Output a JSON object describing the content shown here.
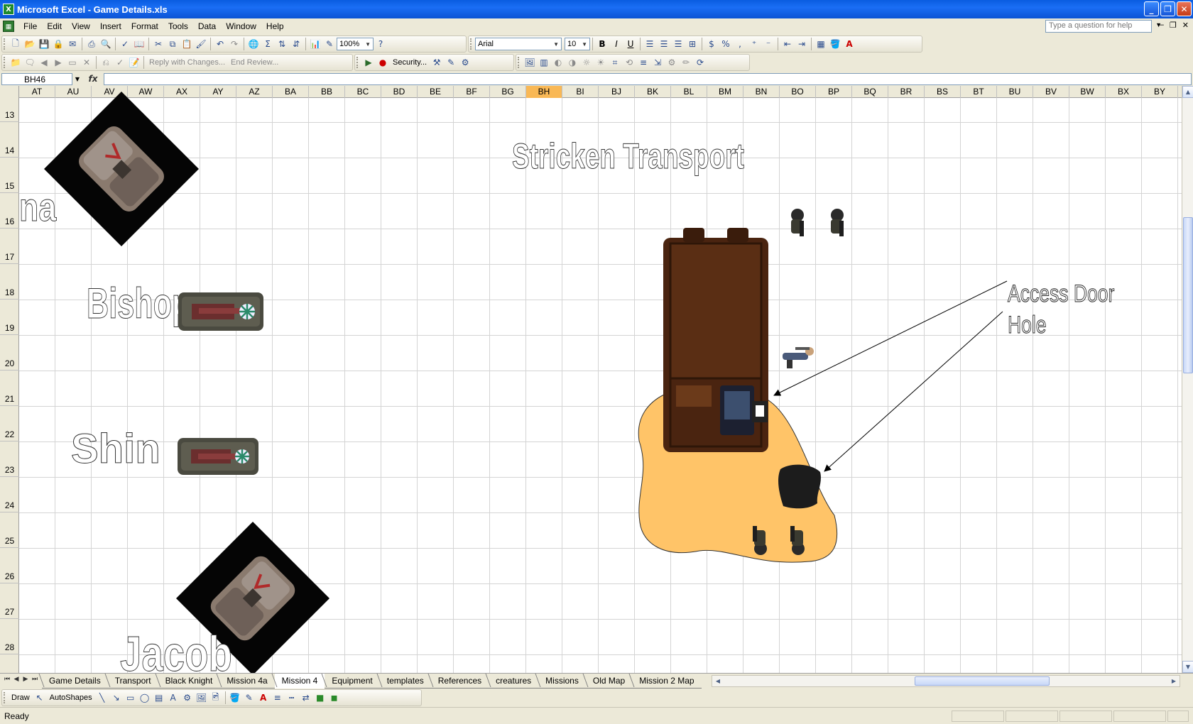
{
  "window": {
    "title": "Microsoft Excel - Game Details.xls"
  },
  "menu": [
    "File",
    "Edit",
    "View",
    "Insert",
    "Format",
    "Tools",
    "Data",
    "Window",
    "Help"
  ],
  "help_placeholder": "Type a question for help",
  "toolbar": {
    "zoom": "100%",
    "font": "Arial",
    "font_size": "10",
    "reply_with_changes": "Reply with Changes...",
    "end_review": "End Review...",
    "security": "Security..."
  },
  "formula_bar": {
    "name_box": "BH46",
    "fx": "fx",
    "content": ""
  },
  "columns": [
    "AT",
    "AU",
    "AV",
    "AW",
    "AX",
    "AY",
    "AZ",
    "BA",
    "BB",
    "BC",
    "BD",
    "BE",
    "BF",
    "BG",
    "BH",
    "BI",
    "BJ",
    "BK",
    "BL",
    "BM",
    "BN",
    "BO",
    "BP",
    "BQ",
    "BR",
    "BS",
    "BT",
    "BU",
    "BV",
    "BW",
    "BX",
    "BY"
  ],
  "active_column": "BH",
  "rows": [
    "13",
    "14",
    "15",
    "16",
    "17",
    "18",
    "19",
    "20",
    "21",
    "22",
    "23",
    "24",
    "25",
    "26",
    "27",
    "28"
  ],
  "sheet": {
    "title": "Stricken Transport",
    "labels": {
      "partial": "na",
      "bishop": "Bishop",
      "shin": "Shin",
      "jacob": "Jacob"
    },
    "callouts": {
      "access_door": "Access Door",
      "hole": "Hole"
    }
  },
  "tabs": [
    "Game Details",
    "Transport",
    "Black Knight",
    "Mission 4a",
    "Mission 4",
    "Equipment",
    "templates",
    "References",
    "creatures",
    "Missions",
    "Old Map",
    "Mission 2 Map"
  ],
  "active_tab": "Mission 4",
  "drawbar": {
    "draw": "Draw",
    "autoshapes": "AutoShapes"
  },
  "status": "Ready",
  "colors": {
    "sand": "#ffc468",
    "hull": "#5a2e14",
    "hole": "#1c1c1c",
    "active_header": "#f9b855"
  }
}
